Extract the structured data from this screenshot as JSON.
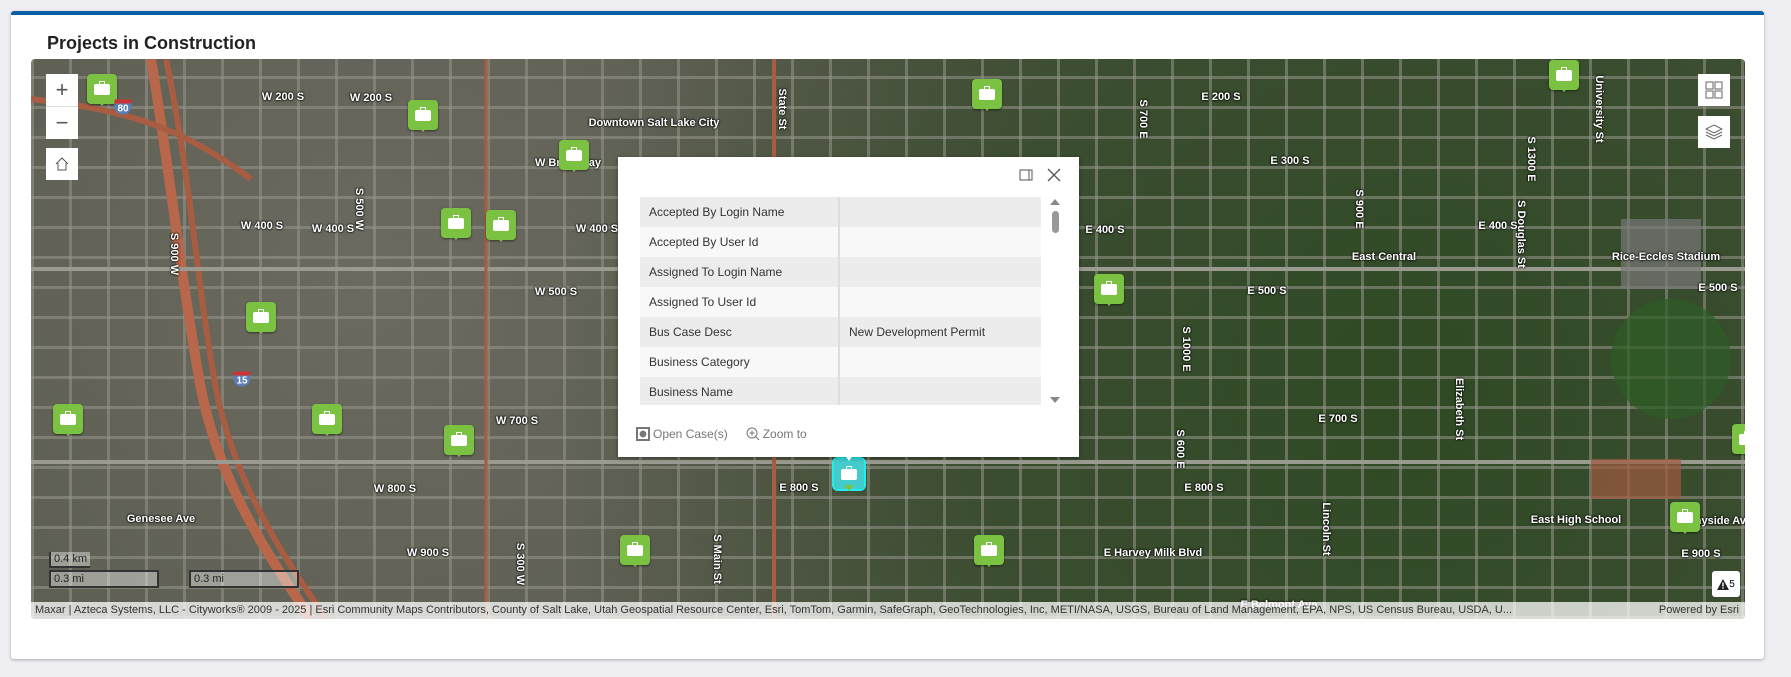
{
  "card": {
    "title": "Projects in Construction"
  },
  "map": {
    "controls": {
      "zoom_in": "+",
      "zoom_out": "−"
    },
    "labels": [
      "W 200 S",
      "W 200 S",
      "Downtown Salt Lake City",
      "W Broadway",
      "W 400 S",
      "W 400 S",
      "W 500 S",
      "W 700 S",
      "W 800 S",
      "E 800 S",
      "E 800 S",
      "Genesee Ave",
      "W 900 S",
      "E Harvey Milk Blvd",
      "E Belmont Ave",
      "E 900 S",
      "Sunnyside Ave",
      "East High School",
      "E 700 S",
      "E 500 S",
      "E 500 S",
      "East Central",
      "Rice-Eccles Stadium",
      "E 400 S",
      "E 400 S",
      "E 300 S",
      "E 200 S",
      "W 400 S"
    ],
    "vlabels": [
      "S 300 W",
      "State St",
      "S 700 E",
      "S Main St",
      "S 1000 E",
      "Lincoln St",
      "S 500 W",
      "S 900 W",
      "Elizabeth St",
      "University St",
      "S 600 E",
      "S 900 E",
      "S 1300 E",
      "S Douglas St"
    ],
    "highway_shields": [
      "80",
      "15"
    ],
    "scale": {
      "km": "0.4 km",
      "mi": "0.3 mi",
      "mi2": "0.3 mi"
    },
    "attribution": "Maxar | Azteca Systems, LLC - Cityworks® 2009 - 2025 | Esri Community Maps Contributors, County of Salt Lake, Utah Geospatial Resource Center, Esri, TomTom, Garmin, SafeGraph, GeoTechnologies, Inc, METI/NASA, USGS, Bureau of Land Management, EPA, NPS, US Census Bureau, USDA, U...",
    "powered_by": "Powered by Esri",
    "warning_count": "5",
    "marker_color": "#7cc242",
    "selected_marker_color": "#44cccc"
  },
  "popup": {
    "rows": [
      {
        "field": "Accepted By Login Name",
        "value": ""
      },
      {
        "field": "Accepted By User Id",
        "value": ""
      },
      {
        "field": "Assigned To Login Name",
        "value": ""
      },
      {
        "field": "Assigned To User Id",
        "value": ""
      },
      {
        "field": "Bus Case Desc",
        "value": "New Development Permit"
      },
      {
        "field": "Business Category",
        "value": ""
      },
      {
        "field": "Business Name",
        "value": ""
      }
    ],
    "actions": {
      "open_cases": "Open Case(s)",
      "zoom_to": "Zoom to"
    }
  },
  "colors": {
    "accent": "#0b5fa5"
  }
}
